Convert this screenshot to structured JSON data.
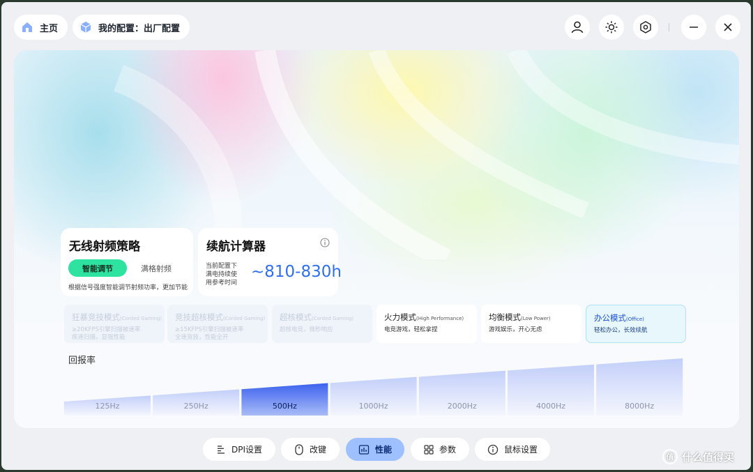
{
  "topbar": {
    "home_label": "主页",
    "config_label": "我的配置：出厂配置",
    "icons": [
      "user-icon",
      "brightness-icon",
      "settings-icon",
      "minimize-icon",
      "close-icon"
    ]
  },
  "rf_strategy": {
    "title": "无线射频策略",
    "option_smart": "智能调节",
    "option_full": "满格射频",
    "description": "根据信号强度智能调节射频功率，更加节能"
  },
  "battery": {
    "title": "续航计算器",
    "description": "当前配置下满电持续使用参考时间",
    "value": "~810-830h"
  },
  "modes": [
    {
      "name": "狂暴竞技模式",
      "sub": "(Corded Gaming)",
      "desc1": "≥20KFPS引擎扫描被速率",
      "desc2": "疾速扫描，显强性能",
      "state": "disabled"
    },
    {
      "name": "竞技超核模式",
      "sub": "(Corded Gaming)",
      "desc1": "≥15KFPS引擎扫描被速率",
      "desc2": "全速竞技，性能全开",
      "state": "disabled"
    },
    {
      "name": "超核模式",
      "sub": "(Corded Gaming)",
      "desc1": "超核电竞，微秒响应",
      "desc2": "",
      "state": "disabled"
    },
    {
      "name": "火力模式",
      "sub": "(High Performance)",
      "desc1": "电竞游戏，轻松拿捏",
      "desc2": "",
      "state": "normal"
    },
    {
      "name": "均衡模式",
      "sub": "(Low Power)",
      "desc1": "游戏娱乐，开心无虑",
      "desc2": "",
      "state": "normal"
    },
    {
      "name": "办公模式",
      "sub": "(Office)",
      "desc1": "轻松办公，长效续航",
      "desc2": "",
      "state": "active"
    }
  ],
  "polling_rate": {
    "label": "回报率",
    "options": [
      "125Hz",
      "250Hz",
      "500Hz",
      "1000Hz",
      "2000Hz",
      "4000Hz",
      "8000Hz"
    ],
    "selected": "500Hz"
  },
  "nav": {
    "dpi": "DPI设置",
    "keys": "改键",
    "performance": "性能",
    "params": "参数",
    "mouse": "鼠标设置",
    "active": "performance"
  },
  "watermark": {
    "text": "什么值得买",
    "logo": "值"
  },
  "colors": {
    "accent": "#2f6ff0",
    "toggle_on": "#2ee3a0",
    "nav_active": "#9ec0ff"
  }
}
